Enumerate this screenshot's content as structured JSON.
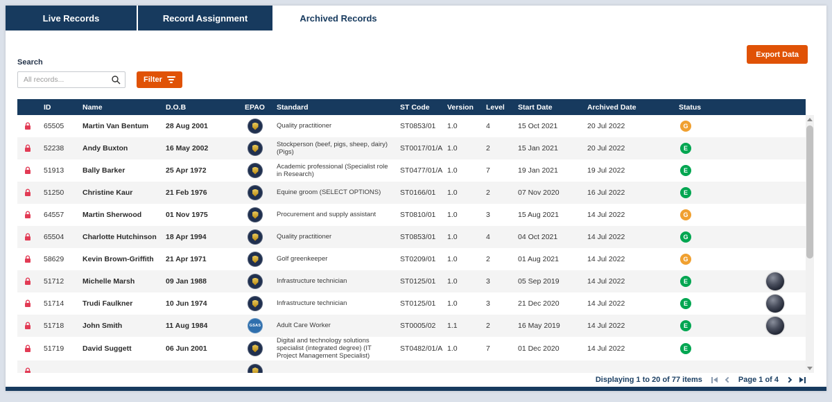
{
  "tabs": [
    {
      "label": "Live Records",
      "active": false
    },
    {
      "label": "Record Assignment",
      "active": false
    },
    {
      "label": "Archived Records",
      "active": true
    }
  ],
  "toolbar": {
    "export_label": "Export Data",
    "search_label": "Search",
    "search_placeholder": "All records...",
    "filter_label": "Filter"
  },
  "table": {
    "columns": [
      "ID",
      "Name",
      "D.O.B",
      "EPAO",
      "Standard",
      "ST Code",
      "Version",
      "Level",
      "Start Date",
      "Archived Date",
      "Status"
    ],
    "partial_row_visible": true,
    "rows": [
      {
        "id": "65505",
        "name": "Martin Van Bentum",
        "dob": "28 Aug 2001",
        "epao": "",
        "standard": "Quality practitioner",
        "st_code": "ST0853/01",
        "version": "1.0",
        "level": "4",
        "start_date": "15 Oct 2021",
        "archived_date": "20 Jul 2022",
        "status": {
          "letter": "G",
          "color": "amber"
        },
        "avatar": false
      },
      {
        "id": "52238",
        "name": "Andy Buxton",
        "dob": "16 May 2002",
        "epao": "",
        "standard": "Stockperson (beef, pigs, sheep, dairy) (Pigs)",
        "st_code": "ST0017/01/A",
        "version": "1.0",
        "level": "2",
        "start_date": "15 Jan 2021",
        "archived_date": "20 Jul 2022",
        "status": {
          "letter": "E",
          "color": "green"
        },
        "avatar": false
      },
      {
        "id": "51913",
        "name": "Bally Barker",
        "dob": "25 Apr 1972",
        "epao": "",
        "standard": "Academic professional (Specialist role in Research)",
        "st_code": "ST0477/01/A",
        "version": "1.0",
        "level": "7",
        "start_date": "19 Jan 2021",
        "archived_date": "19 Jul 2022",
        "status": {
          "letter": "E",
          "color": "green"
        },
        "avatar": false
      },
      {
        "id": "51250",
        "name": "Christine Kaur",
        "dob": "21 Feb 1976",
        "epao": "",
        "standard": "Equine groom (SELECT OPTIONS)",
        "st_code": "ST0166/01",
        "version": "1.0",
        "level": "2",
        "start_date": "07 Nov 2020",
        "archived_date": "16 Jul 2022",
        "status": {
          "letter": "E",
          "color": "green"
        },
        "avatar": false
      },
      {
        "id": "64557",
        "name": "Martin Sherwood",
        "dob": "01 Nov 1975",
        "epao": "",
        "standard": "Procurement and supply assistant",
        "st_code": "ST0810/01",
        "version": "1.0",
        "level": "3",
        "start_date": "15 Aug 2021",
        "archived_date": "14 Jul 2022",
        "status": {
          "letter": "G",
          "color": "amber"
        },
        "avatar": false
      },
      {
        "id": "65504",
        "name": "Charlotte Hutchinson",
        "dob": "18 Apr 1994",
        "epao": "",
        "standard": "Quality practitioner",
        "st_code": "ST0853/01",
        "version": "1.0",
        "level": "4",
        "start_date": "04 Oct 2021",
        "archived_date": "14 Jul 2022",
        "status": {
          "letter": "G",
          "color": "green"
        },
        "avatar": false
      },
      {
        "id": "58629",
        "name": "Kevin Brown-Griffith",
        "dob": "21 Apr 1971",
        "epao": "",
        "standard": "Golf greenkeeper",
        "st_code": "ST0209/01",
        "version": "1.0",
        "level": "2",
        "start_date": "01 Aug 2021",
        "archived_date": "14 Jul 2022",
        "status": {
          "letter": "G",
          "color": "amber"
        },
        "avatar": false
      },
      {
        "id": "51712",
        "name": "Michelle Marsh",
        "dob": "09 Jan 1988",
        "epao": "",
        "standard": "Infrastructure technician",
        "st_code": "ST0125/01",
        "version": "1.0",
        "level": "3",
        "start_date": "05 Sep 2019",
        "archived_date": "14 Jul 2022",
        "status": {
          "letter": "E",
          "color": "green"
        },
        "avatar": true
      },
      {
        "id": "51714",
        "name": "Trudi Faulkner",
        "dob": "10 Jun 1974",
        "epao": "",
        "standard": "Infrastructure technician",
        "st_code": "ST0125/01",
        "version": "1.0",
        "level": "3",
        "start_date": "21 Dec 2020",
        "archived_date": "14 Jul 2022",
        "status": {
          "letter": "E",
          "color": "green"
        },
        "avatar": true
      },
      {
        "id": "51718",
        "name": "John Smith",
        "dob": "11 Aug 1984",
        "epao": "GSAS",
        "standard": "Adult Care Worker",
        "st_code": "ST0005/02",
        "version": "1.1",
        "level": "2",
        "start_date": "16 May 2019",
        "archived_date": "14 Jul 2022",
        "status": {
          "letter": "E",
          "color": "green"
        },
        "avatar": true
      },
      {
        "id": "51719",
        "name": "David Suggett",
        "dob": "06 Jun 2001",
        "epao": "",
        "standard": "Digital and technology solutions specialist (integrated degree) (IT Project Management Specialist)",
        "st_code": "ST0482/01/A",
        "version": "1.0",
        "level": "7",
        "start_date": "01 Dec 2020",
        "archived_date": "14 Jul 2022",
        "status": {
          "letter": "E",
          "color": "green"
        },
        "avatar": false
      }
    ]
  },
  "pagination": {
    "summary": "Displaying 1 to 20 of 77 items",
    "page_label": "Page 1 of 4"
  },
  "colors": {
    "green": "#00a651",
    "amber": "#f0a030",
    "navy": "#173a5e",
    "orange": "#e05206",
    "lock_red": "#e23b55"
  }
}
